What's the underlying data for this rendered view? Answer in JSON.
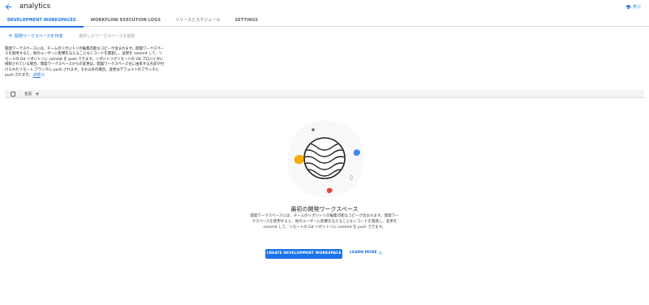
{
  "app": {
    "title": "analytics"
  },
  "header": {
    "learn_label": "学ぶ"
  },
  "tabs": [
    {
      "label": "DEVELOPMENT WORKSPACES",
      "active": true
    },
    {
      "label": "WORKFLOW EXECUTION LOGS",
      "active": false
    },
    {
      "label": "リリースとスケジュール",
      "active": false
    },
    {
      "label": "SETTINGS",
      "active": false
    }
  ],
  "toolbar": {
    "create_label": "開発ワークスペースを作成",
    "delete_label": "選択したワークスペースを削除"
  },
  "description": {
    "text": "開発ワークスペースには、チームのリポジトリの編集可能なコピーが含まれます。開発ワークスペースを使用すると、他のユーザーに影響を与えることなくコードを開発し、変更を commit して、リモートの Git リポジトリに commit を push できます。リポジトリがリモートの Git プロバイダに接続されている場合、開発ワークスペースからの変更は、開発ワークスペース名に由来する名前が付けられたリモート ブランチに push されます。それ以外の場合、変更はデフォルトのブランチに push されます。",
    "link_label": "詳細"
  },
  "table": {
    "name_column": "名前"
  },
  "empty_state": {
    "title": "最初の開発ワークスペース",
    "description": "開発ワークスペースには、チームのリポジトリの編集可能なコピーが含まれます。開発ワークスペースを使用すると、他のユーザーに影響を与えることなくコードを開発し、変更を commit して、リモートの Git リポジトリに commit を push できます。",
    "create_button": "CREATE DEVELOPMENT WORKSPACE",
    "learn_more": "LEARN MORE"
  },
  "colors": {
    "accent": "#1a73e8",
    "text": "#202124",
    "muted": "#5f6368",
    "disabled": "#9aa0a6",
    "yellow": "#f9ab00",
    "red": "#ea4335",
    "blue": "#4285f4"
  },
  "icons": {
    "back": "arrow-left-icon",
    "learn": "school-icon",
    "add": "plus-icon",
    "external": "open-in-new-icon",
    "sort": "arrow-up-icon"
  }
}
